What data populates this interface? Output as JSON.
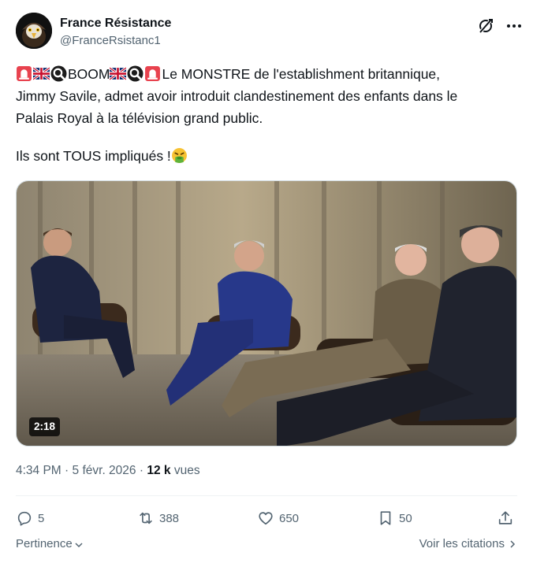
{
  "author": {
    "name": "France Résistance",
    "handle": "@FranceRsistanc1",
    "avatar_icon": "eagle-avatar"
  },
  "tweet": {
    "line1_text_a": "BOOM",
    "line1_text_b": "Le MONSTRE de l'establishment britannique,",
    "line2": "Jimmy Savile, admet avoir introduit clandestinement des enfants dans le",
    "line3": "Palais Royal à la télévision grand public.",
    "line4": "Ils sont TOUS impliqués !",
    "emoji_sequence": [
      "rotating-light-icon",
      "uk-flag-icon",
      "magnifier-icon",
      "uk-flag-icon",
      "magnifier-icon",
      "rotating-light-icon",
      "vomiting-face-icon"
    ]
  },
  "media": {
    "type": "video",
    "duration": "2:18"
  },
  "meta": {
    "time": "4:34 PM",
    "separator": "·",
    "date": "5 févr. 2026",
    "views_count": "12 k",
    "views_label": "vues"
  },
  "actions": {
    "replies": "5",
    "reposts": "388",
    "likes": "650",
    "bookmarks": "50"
  },
  "footer": {
    "sort_label": "Pertinence",
    "quotes_label": "Voir les citations"
  },
  "colors": {
    "text_primary": "#0f1419",
    "text_secondary": "#536471",
    "border": "#cfd9de",
    "divider": "#eff3f4"
  }
}
